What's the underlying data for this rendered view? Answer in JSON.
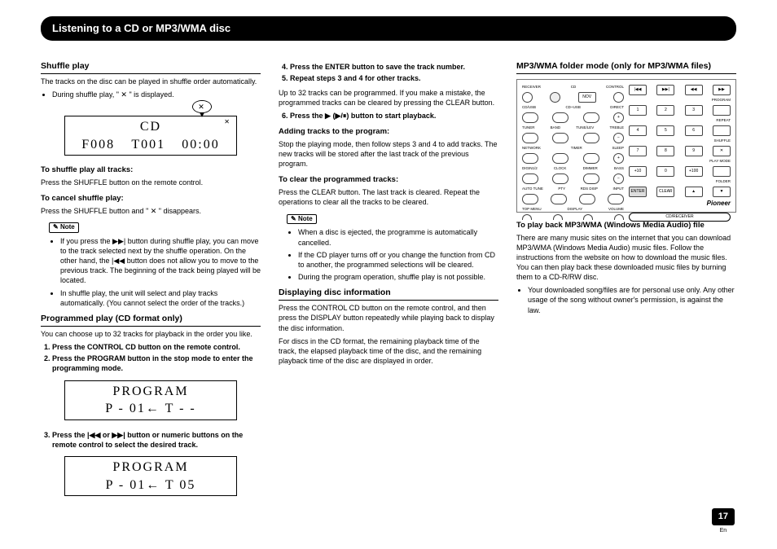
{
  "title_bar": "Listening to a CD or MP3/WMA disc",
  "page_number": "17",
  "page_lang": "En",
  "col1": {
    "h_shuffle": "Shuffle play",
    "p_shuffle1": "The tracks on the disc can be played in shuffle order automatically.",
    "li_shuffle_during": "During shuffle play, \" ✕ \" is displayed.",
    "lcd1_top": "CD",
    "lcd1_f": "F008",
    "lcd1_t": "T001",
    "lcd1_time": "00:00",
    "h_shuffle_all": "To shuffle play all tracks:",
    "p_shuffle_all": "Press the SHUFFLE button on the remote control.",
    "h_cancel_shuffle": "To cancel shuffle play:",
    "p_cancel_shuffle": "Press the SHUFFLE button and \" ✕ \" disappears.",
    "note_label": "Note",
    "note1_li1": "If you press the ▶▶| button during shuffle play, you can move to the track selected next by the shuffle operation. On the other hand, the |◀◀ button does not allow you to move to the previous track. The beginning of the track being played will be located.",
    "note1_li2": "In shuffle play, the unit will select and play tracks automatically. (You cannot select the order of the tracks.)",
    "h_programmed": "Programmed play (CD format only)",
    "p_programmed": "You can choose up to 32 tracks for playback in the order you like.",
    "step1": "Press the CONTROL CD button on the remote control.",
    "step2": "Press the PROGRAM button in the stop mode to enter the programming mode.",
    "lcd2_l1": "PROGRAM",
    "lcd2_l2": "P - 01← T -  -",
    "step3": "Press the  |◀◀ or ▶▶| button or numeric buttons on the remote control to select the desired track.",
    "lcd3_l1": "PROGRAM",
    "lcd3_l2": "P - 01← T 05"
  },
  "col2": {
    "step4": "Press the ENTER button to save the track number.",
    "step5": "Repeat steps 3 and 4 for other tracks.",
    "p_after5": "Up to 32 tracks can be programmed. If you make a mistake, the programmed tracks can be cleared by pressing the CLEAR button.",
    "step6": "Press the ▶ (▶/⏸) button to start playback.",
    "h_adding": "Adding tracks to the program:",
    "p_adding": "Stop the playing mode, then follow steps 3 and 4 to add tracks. The new tracks will be stored after the last track of the previous program.",
    "h_clear": "To clear the programmed tracks:",
    "p_clear": "Press the CLEAR button. The last track is cleared. Repeat the operations to clear all the tracks to be cleared.",
    "note_label": "Note",
    "n2_li1": "When a disc is ejected, the programme is automatically cancelled.",
    "n2_li2": "If the CD player turns off or you change the function from CD to another, the programmed selections will be cleared.",
    "n2_li3": "During the program operation, shuffle play is not possible.",
    "h_display": "Displaying disc information",
    "p_display1": "Press the CONTROL CD button on the remote control, and then press the DISPLAY button repeatedly while playing back to display the disc information.",
    "p_display2": "For discs in the CD format, the remaining playback time of the track, the elapsed playback time of the disc, and the remaining playback time of the disc are displayed in order."
  },
  "col3": {
    "h_mp3": "MP3/WMA folder mode (only for MP3/WMA files)",
    "h_playback": "To play back MP3/WMA (Windows Media Audio) file",
    "p_playback": "There are many music sites on the internet that you can download MP3/WMA (Windows Media Audio) music files. Follow the instructions from the website on how to download the music files. You can then play back these downloaded music files by burning them to a CD-R/RW disc.",
    "li_legal": "Your downloaded song/files are for personal use only. Any other usage of the song without owner's permission, is against the law.",
    "brand": "Pioneer",
    "cdreceiver": "CD/RECEIVER",
    "remote_labels": {
      "r1": [
        "RECEIVER",
        "CD",
        "",
        "CONTROL"
      ],
      "r2": [
        "CD/USB",
        "CD+USB",
        "DIRECT"
      ],
      "r3": [
        "TUNER",
        "BAND",
        "TUNE/LEV",
        "TREBLE"
      ],
      "r4": [
        "NETWORK",
        "TIMER",
        "SLEEP"
      ],
      "r5": [
        "DIGIN1/2",
        "CLOCK",
        "DIMMER",
        "BASS"
      ],
      "r6": [
        "AUTO TUNE",
        "PTY",
        "RDS DISP",
        "INPUT"
      ],
      "r7": [
        "TOP MENU",
        "",
        "DISPLAY",
        "VOLUME"
      ],
      "right_top": [
        "|◀◀",
        "▶▶|",
        "◀◀",
        "▶▶"
      ],
      "right_prog": "PROGRAM",
      "right_nums": [
        "1",
        "2",
        "3"
      ],
      "right_nums2": [
        "4",
        "5",
        "6"
      ],
      "right_repeat": "REPEAT",
      "right_nums3": [
        "7",
        "8",
        "9"
      ],
      "right_shuffle": "SHUFFLE",
      "right_nums4": [
        "+10",
        "0",
        "+100"
      ],
      "right_playmode": "PLAY MODE",
      "right_bot": [
        "ENTER",
        "CLEAR",
        ""
      ],
      "right_folder": "FOLDER"
    }
  }
}
